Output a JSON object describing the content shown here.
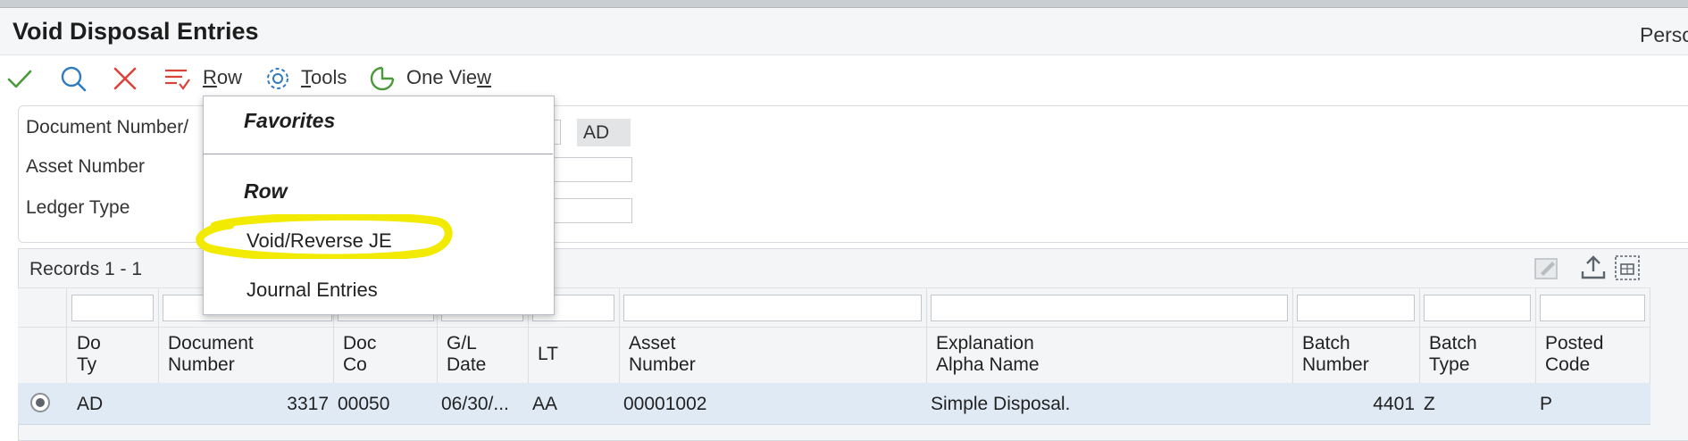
{
  "window": {
    "title": "Void Disposal Entries",
    "user_partial": "Perso"
  },
  "toolbar": {
    "select_icon": "check-icon",
    "find_icon": "search-icon",
    "close_icon": "close-icon",
    "row_label_u": "R",
    "row_label_rest": "ow",
    "tools_label_u": "T",
    "tools_label_rest": "ools",
    "oneview_label_pre": "One Vie",
    "oneview_label_u": "w"
  },
  "filters": {
    "document_number_label": "Document Number/",
    "doc_type_value": "AD",
    "asset_number_label": "Asset Number",
    "ledger_type_label": "Ledger Type"
  },
  "grid": {
    "records_label": "Records 1 - 1",
    "columns": [
      {
        "line1": "Do",
        "line2": "Ty"
      },
      {
        "line1": "Document",
        "line2": "Number"
      },
      {
        "line1": "Doc",
        "line2": "Co"
      },
      {
        "line1": "G/L",
        "line2": "Date"
      },
      {
        "line1": "LT",
        "line2": ""
      },
      {
        "line1": "Asset",
        "line2": "Number"
      },
      {
        "line1": "Explanation",
        "line2": "Alpha Name"
      },
      {
        "line1": "Batch",
        "line2": "Number"
      },
      {
        "line1": "Batch",
        "line2": "Type"
      },
      {
        "line1": "Posted",
        "line2": "Code"
      }
    ],
    "rows": [
      {
        "do_ty": "AD",
        "document_number": "3317",
        "doc_co": "00050",
        "gl_date": "06/30/...",
        "lt": "AA",
        "asset_number": "00001002",
        "explanation": "Simple Disposal.",
        "batch_number": "4401",
        "batch_type": "Z",
        "posted_code": "P"
      }
    ]
  },
  "row_menu": {
    "favorites_heading": "Favorites",
    "row_heading": "Row",
    "items": [
      "Void/Reverse JE",
      "Journal Entries"
    ],
    "highlight_color": "#f2ea00"
  },
  "colors": {
    "accent_blue": "#2e7bbf",
    "check_green": "#4a9a3c",
    "close_red": "#d9433a",
    "selected_row": "#dfeaf5"
  }
}
